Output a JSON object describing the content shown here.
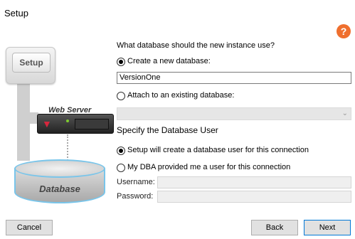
{
  "window": {
    "title": "Setup"
  },
  "help": {
    "icon": "help-icon",
    "glyph": "?",
    "color": "#ef6f2e"
  },
  "illustration": {
    "setup_label": "Setup",
    "server_label": "Web Server",
    "database_label": "Database"
  },
  "form": {
    "question": "What database should the new instance use?",
    "create_option": {
      "label": "Create a new database:",
      "selected": true
    },
    "create_value": "VersionOne",
    "attach_option": {
      "label": "Attach to an existing database:",
      "selected": false
    },
    "section_title": "Specify the Database User",
    "user_option_setup": {
      "label": "Setup will create a database user for this connection",
      "selected": true
    },
    "user_option_dba": {
      "label": "My DBA provided me a user for this connection",
      "selected": false
    },
    "username_label": "Username:",
    "password_label": "Password:"
  },
  "buttons": {
    "cancel": "Cancel",
    "back": "Back",
    "next": "Next"
  }
}
